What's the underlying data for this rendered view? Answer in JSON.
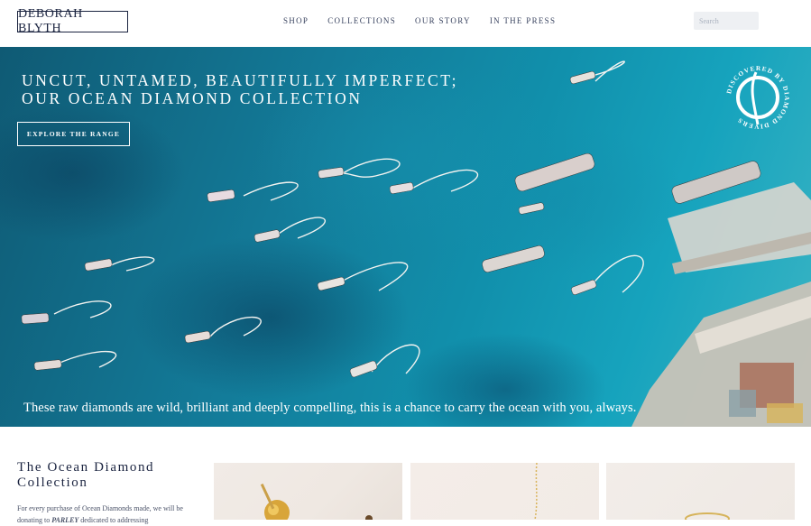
{
  "brand": {
    "logo_text": "DEBORAH BLYTH"
  },
  "nav": {
    "items": [
      "SHOP",
      "COLLECTIONS",
      "OUR STORY",
      "IN THE PRESS"
    ]
  },
  "search": {
    "placeholder": "Search"
  },
  "hero": {
    "title_line1": "UNCUT, UNTAMED, BEAUTIFULLY IMPERFECT;",
    "title_line2": "OUR OCEAN DIAMOND COLLECTION",
    "button_label": "EXPLORE THE RANGE",
    "caption": "These raw diamonds are wild, brilliant and deeply compelling, this is a chance to carry the ocean with you, always.",
    "badge_text": "DISCOVERED BY DIAMOND DIVERS"
  },
  "collection": {
    "title_line1": "The Ocean Diamond",
    "title_line2": "Collection",
    "text_before": "For every purchase of Ocean Diamonds made, we will be donating to ",
    "text_brand": "PARLEY",
    "text_after": " dedicated to addressing"
  },
  "colors": {
    "navy": "#1b2440",
    "ocean": "#137a98",
    "sand": "#efe8e2"
  }
}
